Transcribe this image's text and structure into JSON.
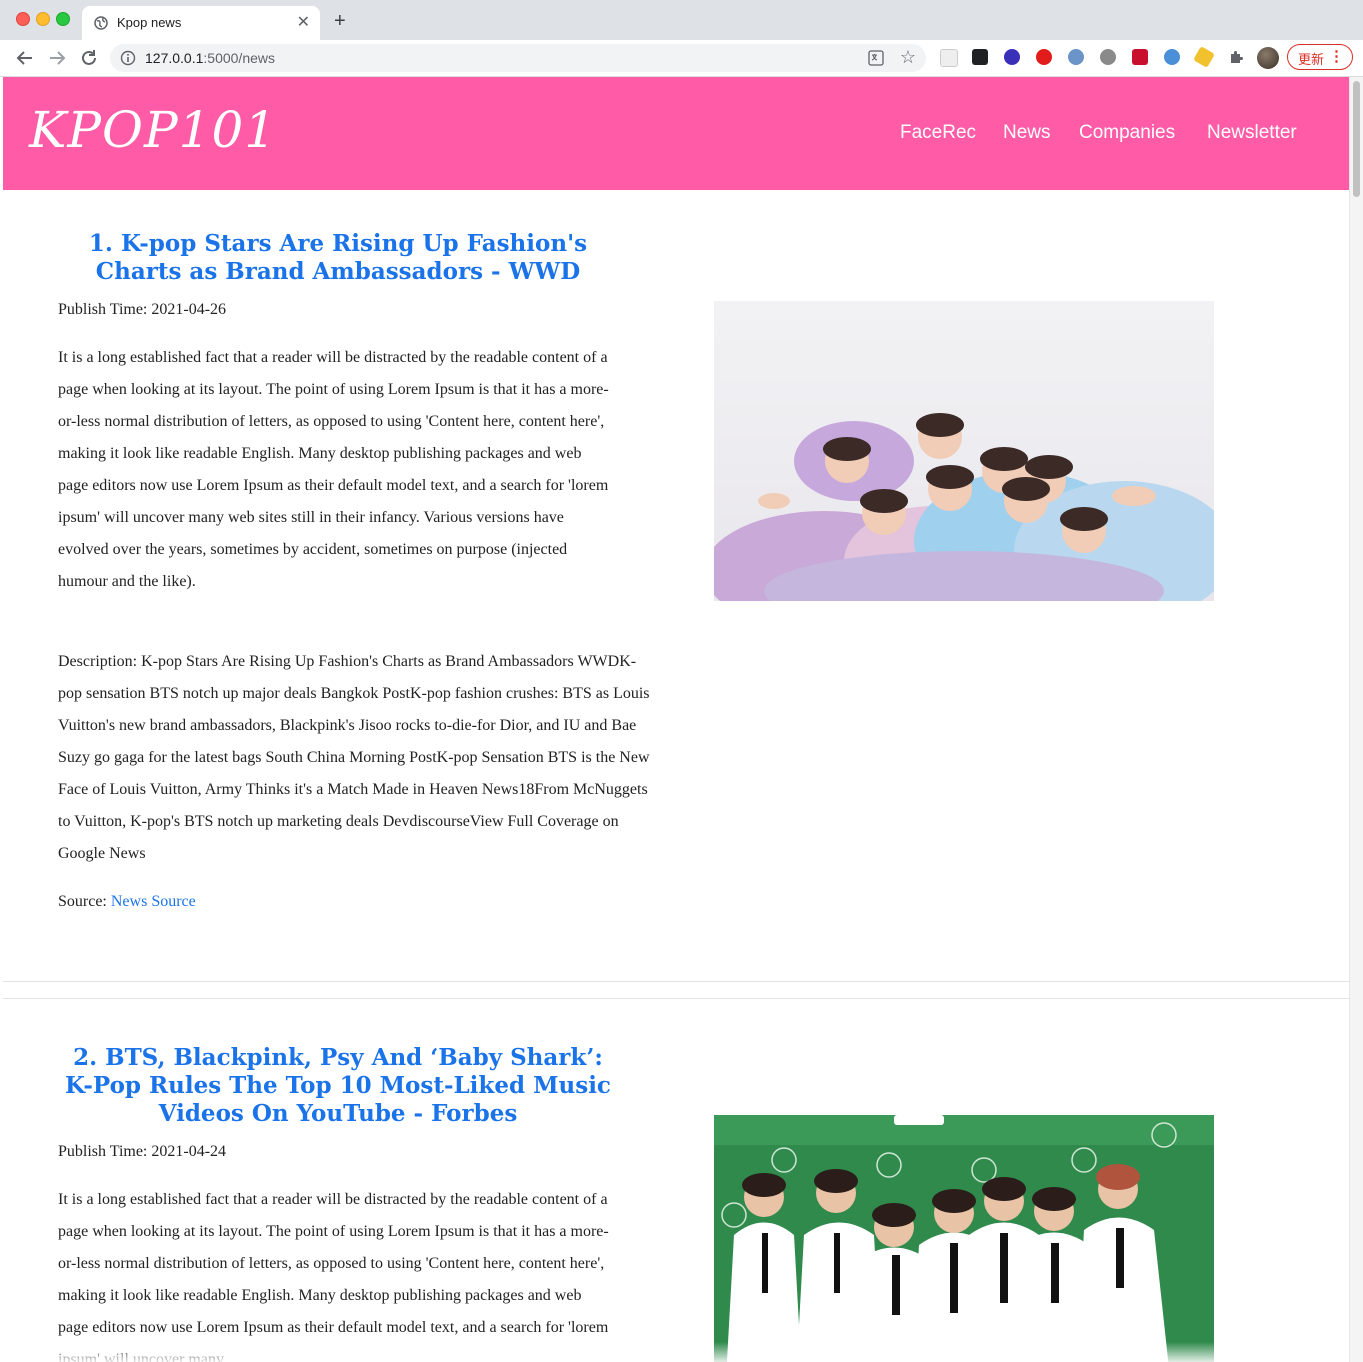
{
  "browser": {
    "tab_title": "Kpop news",
    "url_host": "127.0.0.1",
    "url_path": ":5000/news",
    "update_label": "更新"
  },
  "site": {
    "brand": "KPOP101",
    "nav": [
      "FaceRec",
      "News",
      "Companies",
      "Newsletter"
    ],
    "header_color": "#ff5ba6"
  },
  "articles": [
    {
      "title": "1. K-pop Stars Are Rising Up Fashion's Charts as Brand Ambassadors - WWD",
      "publish_label": "Publish Time: 2021-04-26",
      "body": "It is a long established fact that a reader will be distracted by the readable content of a page when looking at its layout. The point of using Lorem Ipsum is that it has a more-or-less normal distribution of letters, as opposed to using 'Content here, content here', making it look like readable English. Many desktop publishing packages and web page editors now use Lorem Ipsum as their default model text, and a search for 'lorem ipsum' will uncover many web sites still in their infancy. Various versions have evolved over the years, sometimes by accident, sometimes on purpose (injected humour and the like).",
      "description": "Description: K-pop Stars Are Rising Up Fashion's Charts as Brand Ambassadors WWDK-pop sensation BTS notch up major deals Bangkok PostK-pop fashion crushes: BTS as Louis Vuitton's new brand ambassadors, Blackpink's Jisoo rocks to-die-for Dior, and IU and Bae Suzy go gaga for the latest bags South China Morning PostK-pop Sensation BTS is the New Face of Louis Vuitton, Army Thinks it's a Match Made in Heaven News18From McNuggets to Vuitton, K-pop's BTS notch up marketing deals DevdiscourseView Full Coverage on Google News",
      "source_label": "Source:",
      "source_link": "News Source"
    },
    {
      "title": "2. BTS, Blackpink, Psy And ‘Baby Shark’: K-Pop Rules The Top 10 Most-Liked Music Videos On YouTube - Forbes",
      "publish_label": "Publish Time: 2021-04-24",
      "body": "It is a long established fact that a reader will be distracted by the readable content of a page when looking at its layout. The point of using Lorem Ipsum is that it has a more-or-less normal distribution of letters, as opposed to using 'Content here, content here', making it look like readable English. Many desktop publishing packages and web page editors now use Lorem Ipsum as their default model text, and a search for 'lorem ipsum' will uncover many"
    }
  ]
}
